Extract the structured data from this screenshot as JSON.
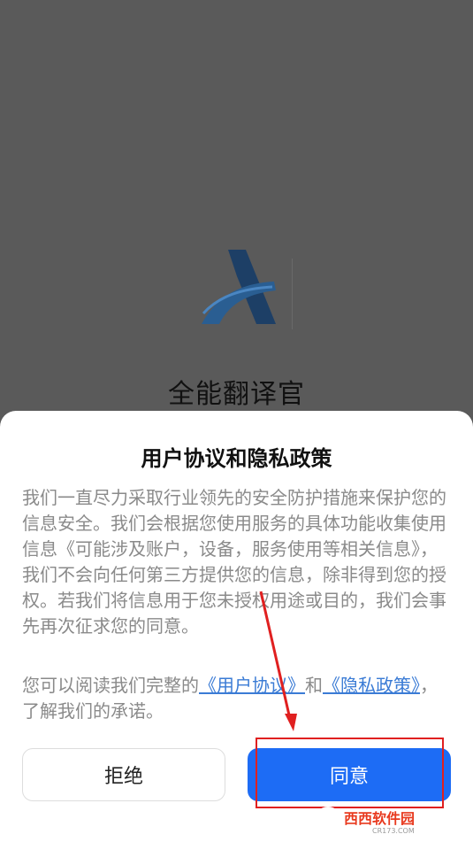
{
  "app": {
    "name": "全能翻译官"
  },
  "dialog": {
    "title": "用户协议和隐私政策",
    "body": "我们一直尽力采取行业领先的安全防护措施来保护您的信息安全。我们会根据您使用服务的具体功能收集使用信息《可能涉及账户，设备，服务使用等相关信息》， 我们不会向任何第三方提供您的信息，除非得到您的授权。若我们将信息用于您未授权用途或目的，我们会事先再次征求您的同意。",
    "links_prefix": "您可以阅读我们完整的",
    "user_agreement_link": "《用户协议》",
    "links_conjunction": "和",
    "privacy_policy_link": "《隐私政策》",
    "links_suffix": "，了解我们的承诺。",
    "refuse_label": "拒绝",
    "agree_label": "同意"
  },
  "watermark": {
    "text": "西西软件园",
    "subtext": "CR173.COM"
  },
  "colors": {
    "primary": "#1d6cf5",
    "link": "#3a7bd5",
    "annotation": "#e02020",
    "overlay": "#5a5a5a"
  },
  "icons": {
    "logo": "app-logo-icon"
  }
}
